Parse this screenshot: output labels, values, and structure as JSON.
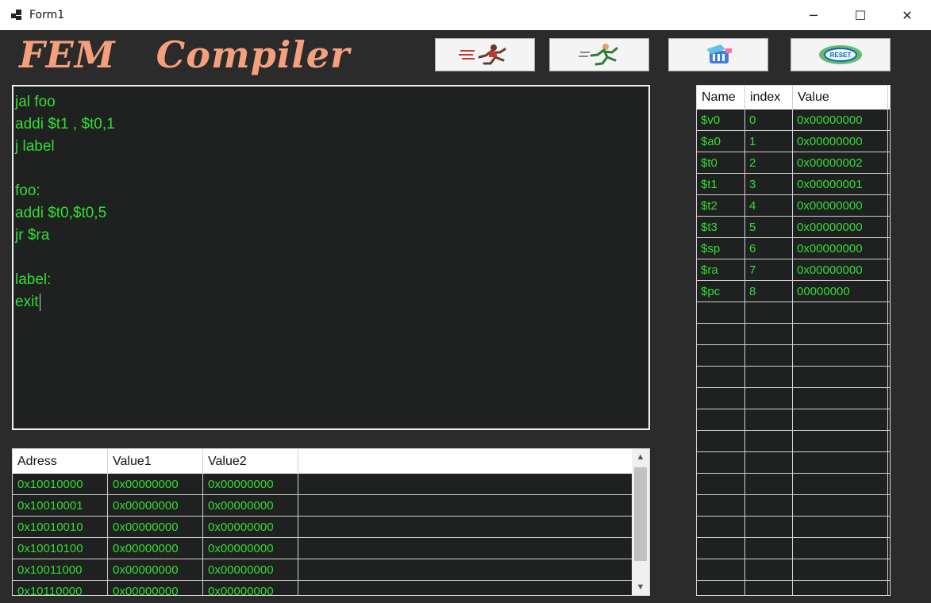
{
  "window": {
    "title": "Form1",
    "minimize_glyph": "─",
    "maximize_glyph": "☐",
    "close_glyph": "✕"
  },
  "logo": {
    "text": "FEM   Compiler"
  },
  "toolbar": [
    {
      "name": "run-button",
      "icon": "runner-fast-icon"
    },
    {
      "name": "step-button",
      "icon": "runner-step-icon"
    },
    {
      "name": "memory-button",
      "icon": "memory-chip-icon"
    },
    {
      "name": "reset-button",
      "icon": "reset-badge-icon",
      "icon_text": "RESET"
    }
  ],
  "editor": {
    "lines": [
      "jal foo",
      "addi $t1 , $t0,1",
      "j label",
      "",
      "foo:",
      "addi $t0,$t0,5",
      "jr $ra",
      "",
      "label:",
      "exit"
    ]
  },
  "memory": {
    "columns": [
      "Adress",
      "Value1",
      "Value2"
    ],
    "rows": [
      [
        "0x10010000",
        "0x00000000",
        "0x00000000"
      ],
      [
        "0x10010001",
        "0x00000000",
        "0x00000000"
      ],
      [
        "0x10010010",
        "0x00000000",
        "0x00000000"
      ],
      [
        "0x10010100",
        "0x00000000",
        "0x00000000"
      ],
      [
        "0x10011000",
        "0x00000000",
        "0x00000000"
      ],
      [
        "0x10110000",
        "0x00000000",
        "0x00000000"
      ]
    ]
  },
  "registers": {
    "columns": [
      "Name",
      "index",
      "Value"
    ],
    "rows": [
      [
        "$v0",
        "0",
        "0x00000000"
      ],
      [
        "$a0",
        "1",
        "0x00000000"
      ],
      [
        "$t0",
        "2",
        "0x00000002"
      ],
      [
        "$t1",
        "3",
        "0x00000001"
      ],
      [
        "$t2",
        "4",
        "0x00000000"
      ],
      [
        "$t3",
        "5",
        "0x00000000"
      ],
      [
        "$sp",
        "6",
        "0x00000000"
      ],
      [
        "$ra",
        "7",
        "0x00000000"
      ],
      [
        "$pc",
        "8",
        "00000000"
      ]
    ]
  },
  "colors": {
    "background": "#2b2b2b",
    "grid_background": "#1e211f",
    "code_text": "#33dd33",
    "logo": "#f4a07c"
  }
}
